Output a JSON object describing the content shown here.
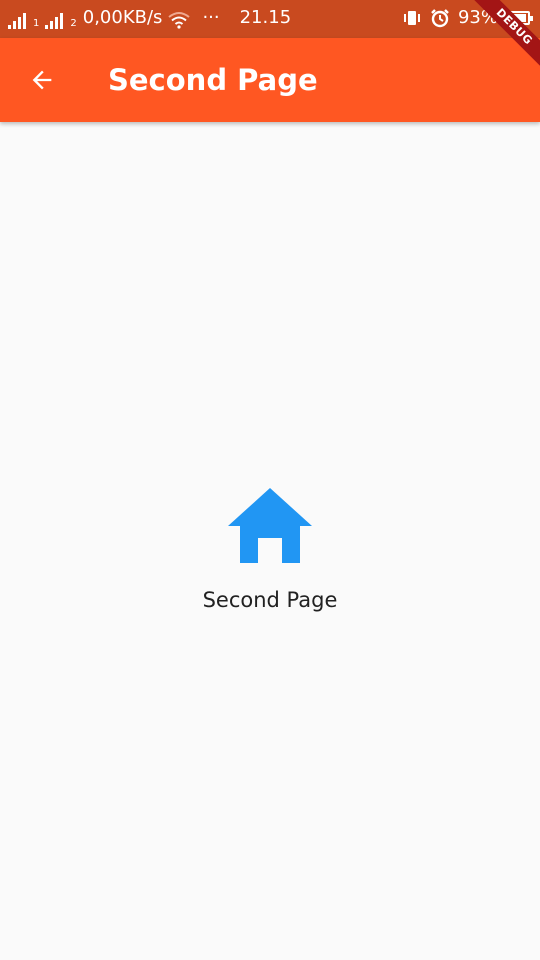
{
  "status_bar": {
    "sim1_label": "1",
    "sim2_label": "2",
    "network_speed": "0,00KB/s",
    "more_dots": "···",
    "time": "21.15",
    "battery_percent": "93%",
    "battery_level": 0.93,
    "icons": [
      "signal-icon",
      "wifi-icon",
      "vibrate-icon",
      "alarm-icon",
      "battery-icon"
    ]
  },
  "app_bar": {
    "title": "Second Page",
    "back_icon": "arrow-back-icon",
    "color": "#ff5722"
  },
  "debug_banner": {
    "label": "DEBUG"
  },
  "body": {
    "icon": "home-icon",
    "icon_color": "#2196f3",
    "label": "Second Page"
  }
}
